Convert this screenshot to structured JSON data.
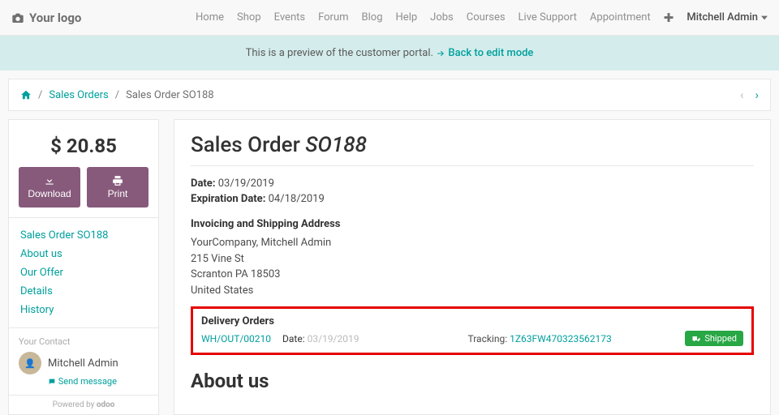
{
  "topbar": {
    "logo_text": "Your logo",
    "nav": [
      "Home",
      "Shop",
      "Events",
      "Forum",
      "Blog",
      "Help",
      "Jobs",
      "Courses",
      "Live Support",
      "Appointment"
    ],
    "user": "Mitchell Admin"
  },
  "preview": {
    "text": "This is a preview of the customer portal.",
    "link": "Back to edit mode"
  },
  "breadcrumb": {
    "l1": "Sales Orders",
    "l2": "Sales Order SO188"
  },
  "sidebar": {
    "price_currency": "$",
    "price_value": "20.85",
    "download": "Download",
    "print": "Print",
    "links": [
      "Sales Order SO188",
      "About us",
      "Our Offer",
      "Details",
      "History"
    ],
    "contact_label": "Your Contact",
    "contact_name": "Mitchell Admin",
    "send_message": "Send message",
    "powered": "Powered by",
    "brand": "odoo"
  },
  "order": {
    "title_prefix": "Sales Order ",
    "title_ref": "SO188",
    "date_label": "Date:",
    "date_value": "03/19/2019",
    "exp_label": "Expiration Date:",
    "exp_value": "04/18/2019",
    "addr_heading": "Invoicing and Shipping Address",
    "addr_lines": [
      "YourCompany, Mitchell Admin",
      "215 Vine St",
      "Scranton PA 18503",
      "United States"
    ],
    "delivery_heading": "Delivery Orders",
    "delivery_ref": "WH/OUT/00210",
    "delivery_date_label": "Date:",
    "delivery_date_value": "03/19/2019",
    "tracking_label": "Tracking:",
    "tracking_value": "1Z63FW470323562173",
    "shipped_label": "Shipped",
    "about_heading": "About us"
  }
}
